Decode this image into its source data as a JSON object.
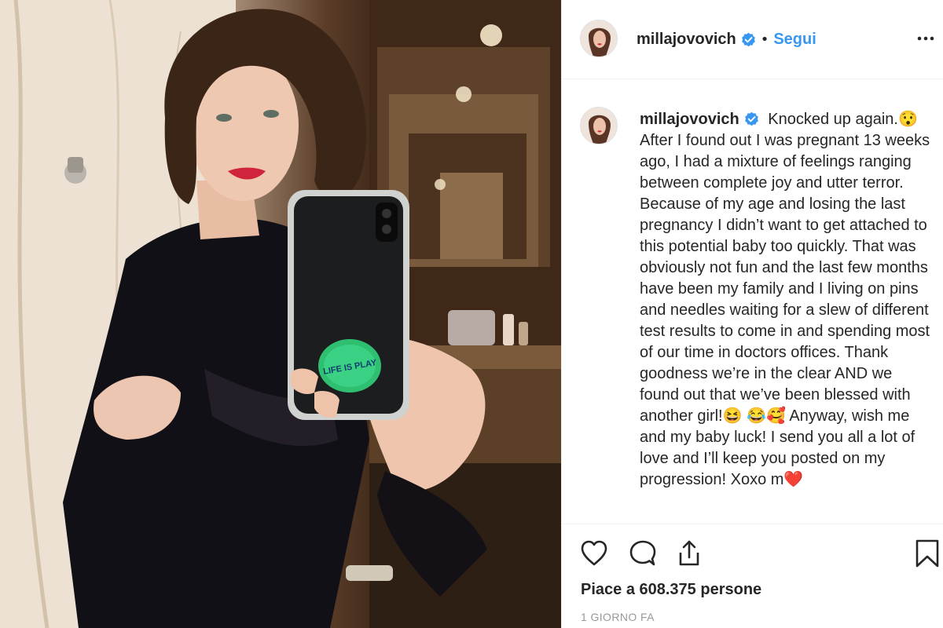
{
  "post": {
    "username": "millajovovich",
    "verified": true,
    "separator": "•",
    "follow_label": "Segui",
    "photo_sticker_text": "LIFE IS PLAY",
    "caption_text": "Knocked up again.😯 After I found out I was pregnant 13 weeks ago, I had a mixture of feelings ranging between complete joy and utter terror. Because of my age and losing the last pregnancy I didn’t want to get attached to this potential baby too quickly. That was obviously not fun and the last few months have been my family and I living on pins and needles waiting for a slew of different test results to come in and spending most of our time in doctors offices. Thank goodness we’re in the clear AND we found out that we’ve been blessed with another girl!😆 😂🥰 Anyway, wish me and my baby luck! I send you all a lot of love and I’ll keep you posted on my progression! Xoxo m❤️",
    "likes_text": "Piace a 608.375 persone",
    "timestamp": "1 GIORNO FA"
  },
  "icons": {
    "verified": "verified-badge-icon",
    "more": "more-options-icon",
    "like": "heart-icon",
    "comment": "comment-bubble-icon",
    "share": "share-icon",
    "save": "bookmark-icon"
  },
  "colors": {
    "accent": "#3897f0",
    "text": "#262626",
    "muted": "#999999",
    "border": "#efefef"
  }
}
